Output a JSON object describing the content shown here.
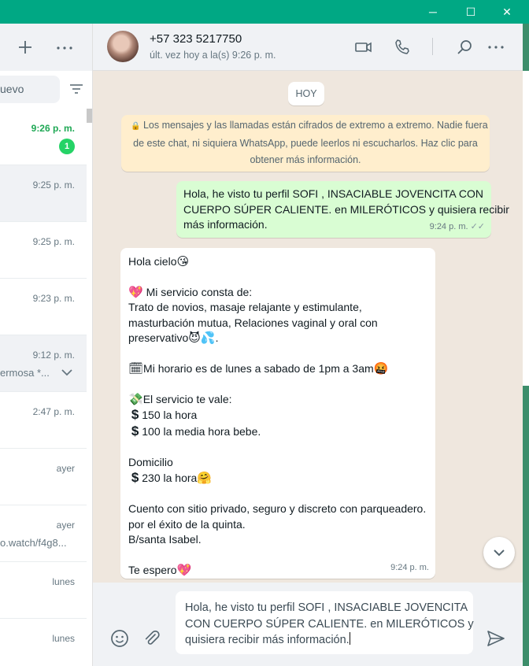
{
  "window": {
    "minimize_glyph": "─",
    "maximize_glyph": "☐",
    "close_glyph": "✕"
  },
  "left_panel": {
    "search_placeholder": "uevo",
    "chats": [
      {
        "time": "9:26 p. m.",
        "unread": "1",
        "snippet": "",
        "selected": false
      },
      {
        "time": "9:25 p. m.",
        "snippet": "",
        "selected": true
      },
      {
        "time": "9:25 p. m.",
        "snippet": "",
        "selected": false
      },
      {
        "time": "9:23 p. m.",
        "snippet": "",
        "selected": false
      },
      {
        "time": "9:12 p. m.",
        "snippet": "ermosa *...",
        "selected": false
      },
      {
        "time": "2:47 p. m.",
        "snippet": "",
        "selected": false
      },
      {
        "time": "ayer",
        "snippet": "",
        "selected": false
      },
      {
        "time": "ayer",
        "snippet": "o.watch/f4g8...",
        "selected": false
      },
      {
        "time": "lunes",
        "snippet": "",
        "selected": false
      },
      {
        "time": "lunes",
        "snippet": "",
        "selected": false
      }
    ]
  },
  "chat": {
    "contact_name": "+57 323 5217750",
    "contact_status": "últ. vez hoy a la(s) 9:26 p. m.",
    "day_divider": "HOY",
    "encryption_notice": {
      "lock_icon": "🔒",
      "line1": "Los mensajes y las llamadas están cifrados de extremo a extremo. Nadie fuera",
      "line2": "de este chat, ni siquiera WhatsApp, puede leerlos ni escucharlos. Haz clic para",
      "line3": "obtener más información."
    },
    "outgoing": {
      "line1": "Hola, he visto tu perfil SOFI , INSACIABLE JOVENCITA CON",
      "line2": "CUERPO SÚPER CALIENTE. en MILERÓTICOS y quisiera recibir",
      "line3": "más información.",
      "time": "9:24 p. m.",
      "ticks": "✓✓"
    },
    "incoming": {
      "greeting": "Hola cielo",
      "greeting_emoji": "😘",
      "heart_emoji": "💖",
      "service_title": " Mi servicio consta de:",
      "service_l1": "Trato de novios, masaje relajante y estimulante,",
      "service_l2": "masturbación mutua, Relaciones vaginal y oral con",
      "service_l3": "preservativo",
      "service_l3_emoji": "😈💦",
      "service_l3_end": ".",
      "calendar_emoji": "🗓",
      "schedule": "Mi horario es de lunes a sabado de 1pm a 3am",
      "schedule_emoji": "🤬",
      "money_emoji": "💸",
      "price_title": "El servicio te vale:",
      "dollar": "$",
      "price1": " 150 la hora",
      "price2": " 100 la media hora bebe.",
      "domicilio": "Domicilio",
      "price3": " 230 la hora",
      "price3_emoji": "🤗",
      "place_l1": "Cuento con sitio privado, seguro y discreto con parqueadero.",
      "place_l2": "por el éxito de la quinta.",
      "place_l3": "B/santa Isabel.",
      "closing": "Te espero",
      "closing_emoji": "💖",
      "time": "9:24 p. m."
    }
  },
  "composer": {
    "line1": "Hola, he visto tu perfil SOFI , INSACIABLE JOVENCITA",
    "line2": "CON CUERPO SÚPER CALIENTE. en MILERÓTICOS y",
    "line3": "quisiera recibir más información."
  },
  "colors": {
    "accent": "#00a884",
    "outgoing_bubble": "#d9fdd3",
    "unread": "#25d366"
  }
}
